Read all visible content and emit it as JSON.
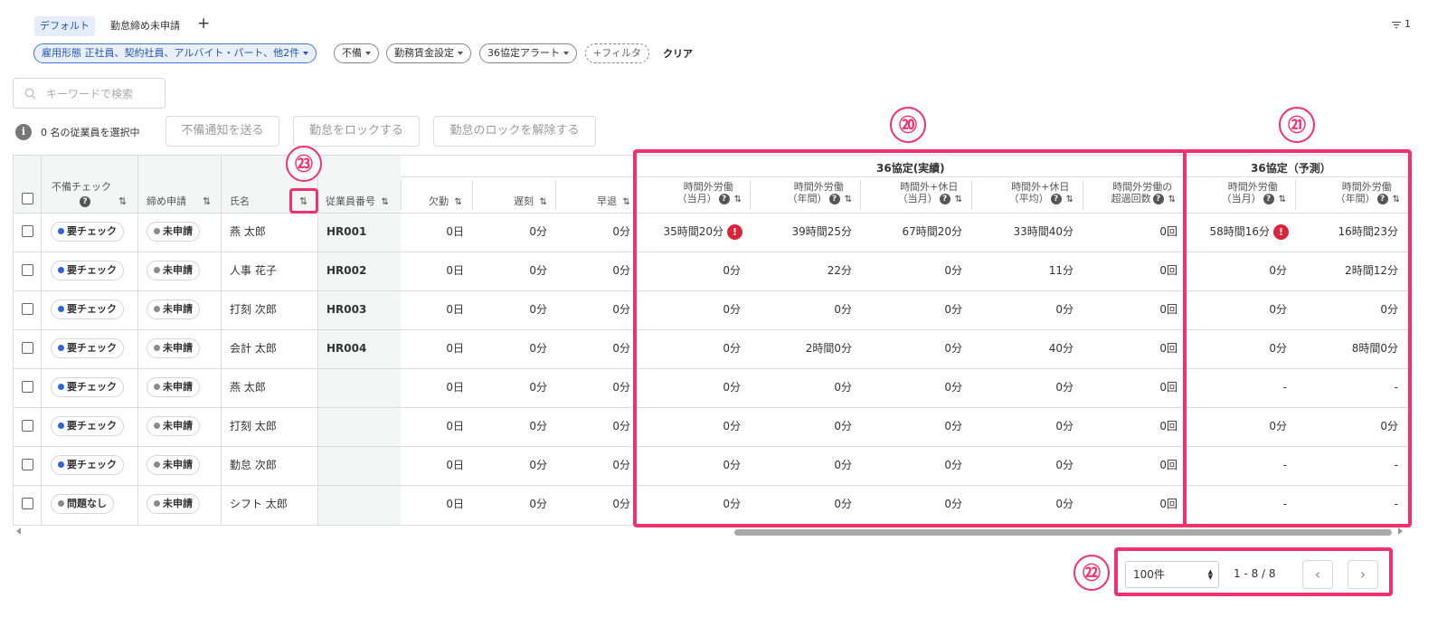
{
  "views": {
    "tabs": [
      "デフォルト",
      "勤怠締め未申請"
    ],
    "add": "+",
    "filter_count": "1"
  },
  "filters": {
    "chips": [
      {
        "key": "雇用形態",
        "value": "正社員、契約社員、アルバイト・パート、他2件"
      },
      {
        "label": "不備"
      },
      {
        "label": "勤務賃金設定"
      },
      {
        "label": "36協定アラート"
      }
    ],
    "add_filter": "+フィルタ",
    "clear": "クリア"
  },
  "search": {
    "placeholder": "キーワードで検索"
  },
  "selection": {
    "info": "i",
    "text": "0 名の従業員を選択中",
    "actions": [
      "不備通知を送る",
      "勤怠をロックする",
      "勤怠のロックを解除する"
    ]
  },
  "table": {
    "sort_symbol": "⇅",
    "help_symbol": "?",
    "alert_symbol": "!",
    "headers": {
      "check": "不備チェック",
      "closing": "締め申請",
      "name": "氏名",
      "emp_no": "従業員番号",
      "absence": "欠勤",
      "late": "遅刻",
      "early": "早退",
      "group_actual": "36協定(実績)",
      "group_forecast": "36協定（予測）",
      "actual": [
        [
          "時間外労働",
          "（当月）"
        ],
        [
          "時間外労働",
          "（年間）"
        ],
        [
          "時間外+休日",
          "（当月）"
        ],
        [
          "時間外+休日",
          "（平均）"
        ],
        [
          "時間外労働の",
          "超過回数"
        ]
      ],
      "forecast": [
        [
          "時間外労働",
          "（当月）"
        ],
        [
          "時間外労働",
          "（年間）"
        ]
      ]
    },
    "rows": [
      {
        "check": "要チェック",
        "check_status": "warn",
        "closing": "未申請",
        "name": "燕 太郎",
        "emp_no": "HR001",
        "absence": "0日",
        "late": "0分",
        "early": "0分",
        "a1": "35時間20分",
        "a1_alert": true,
        "a2": "39時間25分",
        "a3": "67時間20分",
        "a4": "33時間40分",
        "a5": "0回",
        "f1": "58時間16分",
        "f1_alert": true,
        "f2": "16時間23分"
      },
      {
        "check": "要チェック",
        "check_status": "warn",
        "closing": "未申請",
        "name": "人事 花子",
        "emp_no": "HR002",
        "absence": "0日",
        "late": "0分",
        "early": "0分",
        "a1": "0分",
        "a2": "22分",
        "a3": "0分",
        "a4": "11分",
        "a5": "0回",
        "f1": "0分",
        "f2": "2時間12分"
      },
      {
        "check": "要チェック",
        "check_status": "warn",
        "closing": "未申請",
        "name": "打刻 次郎",
        "emp_no": "HR003",
        "absence": "0日",
        "late": "0分",
        "early": "0分",
        "a1": "0分",
        "a2": "0分",
        "a3": "0分",
        "a4": "0分",
        "a5": "0回",
        "f1": "0分",
        "f2": "0分"
      },
      {
        "check": "要チェック",
        "check_status": "warn",
        "closing": "未申請",
        "name": "会計 太郎",
        "emp_no": "HR004",
        "absence": "0日",
        "late": "0分",
        "early": "0分",
        "a1": "0分",
        "a2": "2時間0分",
        "a3": "0分",
        "a4": "40分",
        "a5": "0回",
        "f1": "0分",
        "f2": "8時間0分"
      },
      {
        "check": "要チェック",
        "check_status": "warn",
        "closing": "未申請",
        "name": "燕 太郎",
        "emp_no": "",
        "absence": "0日",
        "late": "0分",
        "early": "0分",
        "a1": "0分",
        "a2": "0分",
        "a3": "0分",
        "a4": "0分",
        "a5": "0回",
        "f1": "-",
        "f2": "-"
      },
      {
        "check": "要チェック",
        "check_status": "warn",
        "closing": "未申請",
        "name": "打刻 太郎",
        "emp_no": "",
        "absence": "0日",
        "late": "0分",
        "early": "0分",
        "a1": "0分",
        "a2": "0分",
        "a3": "0分",
        "a4": "0分",
        "a5": "0回",
        "f1": "0分",
        "f2": "0分"
      },
      {
        "check": "要チェック",
        "check_status": "warn",
        "closing": "未申請",
        "name": "勤怠 次郎",
        "emp_no": "",
        "absence": "0日",
        "late": "0分",
        "early": "0分",
        "a1": "0分",
        "a2": "0分",
        "a3": "0分",
        "a4": "0分",
        "a5": "0回",
        "f1": "-",
        "f2": "-"
      },
      {
        "check": "問題なし",
        "check_status": "ok",
        "closing": "未申請",
        "name": "シフト 太郎",
        "emp_no": "",
        "absence": "0日",
        "late": "0分",
        "early": "0分",
        "a1": "0分",
        "a2": "0分",
        "a3": "0分",
        "a4": "0分",
        "a5": "0回",
        "f1": "-",
        "f2": "-"
      }
    ]
  },
  "pagination": {
    "per_page": "100件",
    "range": "1 - 8 / 8",
    "prev": "‹",
    "next": "›"
  },
  "annotations": {
    "n20": "⑳",
    "n21": "㉑",
    "n22": "㉒",
    "n23": "㉓"
  },
  "colors": {
    "highlight": "#f0306f",
    "dot_warn": "#2f63d6",
    "dot_neutral": "#8a8a8a",
    "alert": "#d9253a",
    "active_tab": "#2456b4"
  }
}
